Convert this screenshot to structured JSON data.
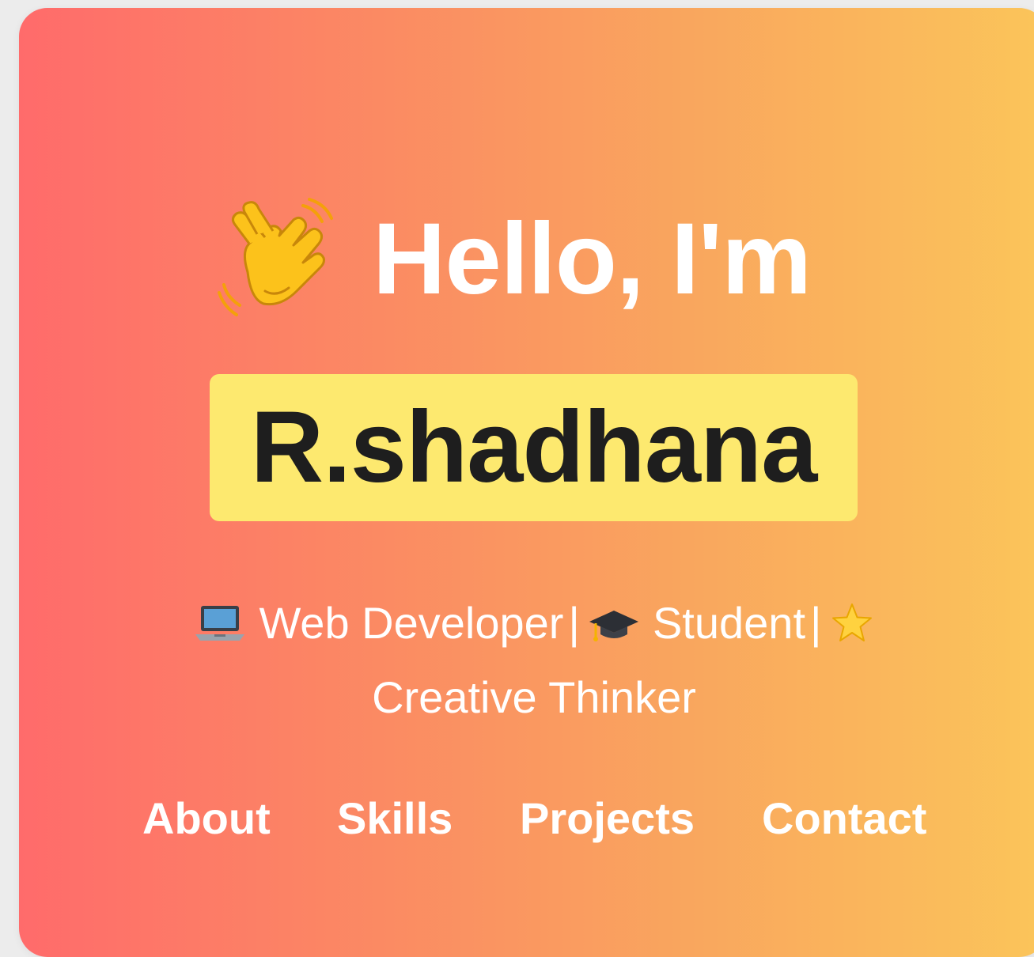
{
  "hero": {
    "greeting": "Hello, I'm",
    "name": "R.shadhana",
    "greeting_icon": "waving-hand-icon",
    "colors": {
      "gradient_start": "#ff6b6b",
      "gradient_end": "#fbc55a",
      "name_highlight": "#fde96f",
      "name_text": "#1e1e1e",
      "text": "#ffffff"
    }
  },
  "tagline": {
    "items": [
      {
        "icon": "laptop-icon",
        "label": "Web Developer"
      },
      {
        "icon": "graduation-cap-icon",
        "label": "Student"
      },
      {
        "icon": "star-icon",
        "label": "Creative Thinker"
      }
    ],
    "separator": "|"
  },
  "nav": {
    "items": [
      {
        "label": "About"
      },
      {
        "label": "Skills"
      },
      {
        "label": "Projects"
      },
      {
        "label": "Contact"
      }
    ]
  }
}
